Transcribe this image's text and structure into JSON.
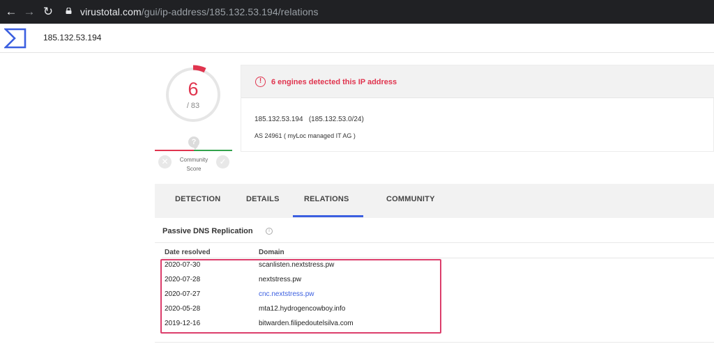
{
  "browser": {
    "url_host": "virustotal.com",
    "url_path": "/gui/ip-address/185.132.53.194/relations",
    "back_glyph": "←",
    "forward_glyph": "→",
    "reload_glyph": "↻"
  },
  "header": {
    "search_value": "185.132.53.194",
    "logo_icon": "virustotal-logo"
  },
  "score": {
    "detections": "6",
    "total": "/ 83",
    "detected_fraction": 0.072,
    "accent_color": "#e0344e",
    "community_question": "?",
    "community_label_line1": "Community",
    "community_label_line2": "Score",
    "vote_down_glyph": "✕",
    "vote_up_glyph": "✓"
  },
  "summary": {
    "alert_glyph": "!",
    "alert_text": "6 engines detected this IP address",
    "ip_line": "185.132.53.194   (185.132.53.0/24)",
    "as_line": "AS 24961 ( myLoc managed IT AG )"
  },
  "tabs": [
    {
      "label": "DETECTION"
    },
    {
      "label": "DETAILS"
    },
    {
      "label": "RELATIONS",
      "active": true
    },
    {
      "label": "COMMUNITY"
    }
  ],
  "passive_dns": {
    "title": "Passive DNS Replication",
    "info_glyph": "i",
    "columns": {
      "date": "Date resolved",
      "domain": "Domain"
    },
    "rows": [
      {
        "date": "2020-07-30",
        "domain": "scanlisten.nextstress.pw",
        "link": false
      },
      {
        "date": "2020-07-28",
        "domain": "nextstress.pw",
        "link": false
      },
      {
        "date": "2020-07-27",
        "domain": "cnc.nextstress.pw",
        "link": true
      },
      {
        "date": "2020-05-28",
        "domain": "mta12.hydrogencowboy.info",
        "link": false
      },
      {
        "date": "2019-12-16",
        "domain": "bitwarden.filipedoutelsilva.com",
        "link": false
      }
    ]
  },
  "colors": {
    "danger": "#e0344e",
    "accent_blue": "#3b5fe0",
    "highlight_box": "#dc3d6b",
    "positive": "#33a34d"
  }
}
